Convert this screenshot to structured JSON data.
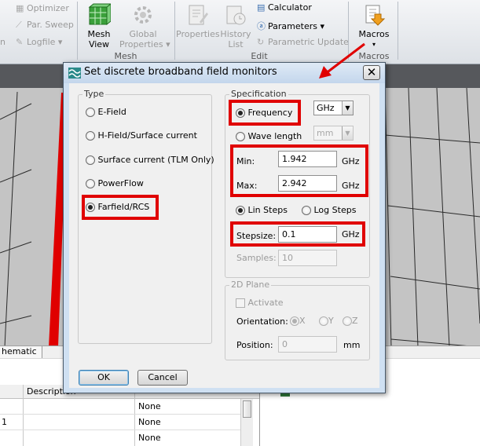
{
  "ribbon": {
    "small_items": [
      {
        "label": "Optimizer",
        "icon": "optimizer-icon"
      },
      {
        "label": "Par. Sweep",
        "icon": "par-sweep-icon"
      },
      {
        "label": "Logfile",
        "icon": "logfile-icon"
      }
    ],
    "mesh_view": {
      "label_line1": "Mesh",
      "label_line2": "View"
    },
    "global_properties": {
      "label_line1": "Global",
      "label_line2": "Properties"
    },
    "properties": {
      "label": "Properties"
    },
    "history_list": {
      "label_line1": "History",
      "label_line2": "List"
    },
    "edit_items": [
      {
        "label": "Calculator",
        "icon": "calculator-icon"
      },
      {
        "label": "Parameters",
        "icon": "parameters-icon"
      },
      {
        "label": "Parametric Update",
        "icon": "parametric-update-icon"
      }
    ],
    "macros": {
      "label": "Macros"
    },
    "groups": {
      "mesh": "Mesh",
      "edit": "Edit",
      "macros": "Macros"
    }
  },
  "workspace": {
    "tab_schematic": "hematic",
    "table": {
      "headers": [
        "Description"
      ],
      "rows": [
        {
          "id": "",
          "type": "None"
        },
        {
          "id": "1",
          "type": "None"
        },
        {
          "id": "",
          "type": "None"
        }
      ]
    }
  },
  "dialog": {
    "title": "Set discrete broadband field monitors",
    "close_glyph": "✕",
    "type_group": {
      "label": "Type",
      "options": [
        {
          "label": "E-Field",
          "selected": false
        },
        {
          "label": "H-Field/Surface current",
          "selected": false
        },
        {
          "label": "Surface current (TLM Only)",
          "selected": false
        },
        {
          "label": "PowerFlow",
          "selected": false
        },
        {
          "label": "Farfield/RCS",
          "selected": true
        }
      ]
    },
    "spec_group": {
      "label": "Specification",
      "frequency_label": "Frequency",
      "wavelength_label": "Wave length",
      "freq_unit": "GHz",
      "length_unit": "mm",
      "min_label": "Min:",
      "min_value": "1.942",
      "min_unit": "GHz",
      "max_label": "Max:",
      "max_value": "2.942",
      "max_unit": "GHz",
      "lin_steps_label": "Lin Steps",
      "log_steps_label": "Log Steps",
      "stepsize_label": "Stepsize:",
      "stepsize_value": "0.1",
      "stepsize_unit": "GHz",
      "samples_label": "Samples:",
      "samples_value": "10"
    },
    "plane_group": {
      "label": "2D Plane",
      "activate_label": "Activate",
      "orientation_label": "Orientation:",
      "orient_x": "X",
      "orient_y": "Y",
      "orient_z": "Z",
      "position_label": "Position:",
      "position_value": "0",
      "position_unit": "mm"
    },
    "ok_label": "OK",
    "cancel_label": "Cancel"
  },
  "colors": {
    "highlight": "#e00000",
    "arrow": "#e00000"
  }
}
